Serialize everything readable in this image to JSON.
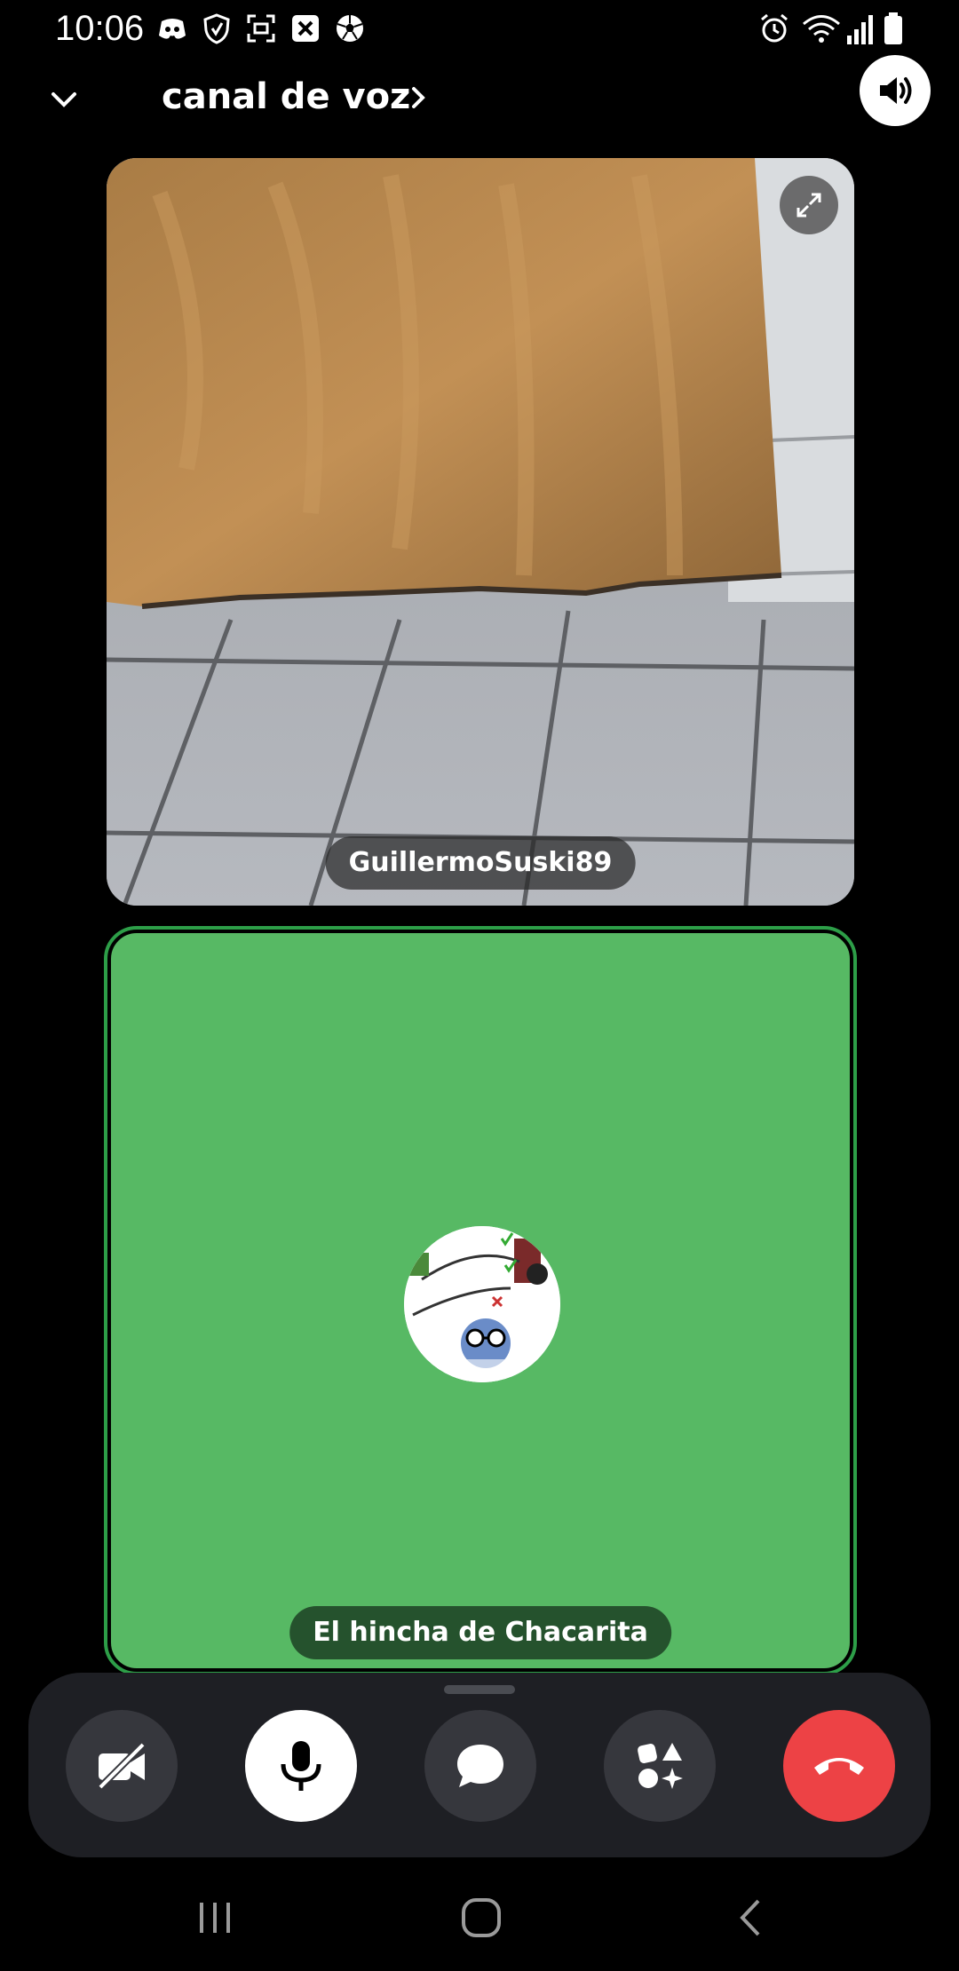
{
  "status_bar": {
    "time": "10:06",
    "left_icons": [
      "discord-icon",
      "shield-hand-icon",
      "screen-record-icon",
      "close-box-icon",
      "soccer-ball-icon"
    ],
    "right_icons": [
      "alarm-icon",
      "wifi-icon",
      "signal-icon",
      "battery-icon"
    ]
  },
  "header": {
    "title": "canal de voz"
  },
  "participants": [
    {
      "name": "GuillermoSuski89",
      "kind": "video"
    },
    {
      "name": "El hincha de Chacarita",
      "kind": "avatar",
      "tile_color": "#57b964",
      "speaking": true
    }
  ],
  "call_controls": [
    {
      "name": "camera-off",
      "icon": "video-off-icon"
    },
    {
      "name": "microphone",
      "icon": "microphone-icon"
    },
    {
      "name": "chat",
      "icon": "chat-bubble-icon"
    },
    {
      "name": "activities",
      "icon": "activities-icon"
    },
    {
      "name": "disconnect",
      "icon": "hang-up-icon",
      "color": "#ed4245"
    }
  ],
  "nav_bar": [
    "recents-icon",
    "home-icon",
    "back-icon"
  ]
}
